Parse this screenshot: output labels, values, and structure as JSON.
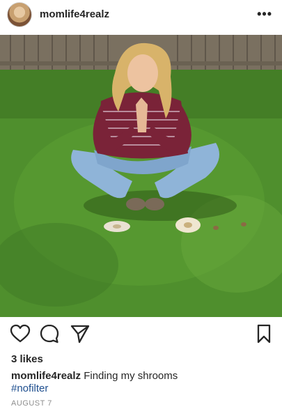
{
  "post": {
    "username": "momlife4realz",
    "more_label": "•••",
    "likes": "3 likes",
    "caption_user": "momlife4realz",
    "caption_text": "Finding my shrooms",
    "hashtag": "#nofilter",
    "date": "AUGUST 7"
  },
  "icons": {
    "like": "heart-icon",
    "comment": "comment-icon",
    "share": "send-icon",
    "save": "bookmark-icon",
    "more": "ellipsis-icon"
  },
  "colors": {
    "text": "#262626",
    "hashtag": "#1f4f8f",
    "date": "#8e8e8e",
    "grass": "#4f8f2d"
  }
}
